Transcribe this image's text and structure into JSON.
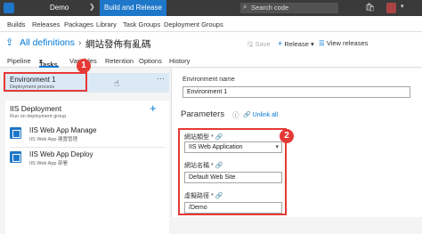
{
  "topbar": {
    "project": "Demo",
    "active_hub": "Build and Release",
    "search_placeholder": "Search code",
    "chevron": "❯",
    "search_icon": "search-icon",
    "cart_icon": "cart-icon"
  },
  "subnav": {
    "items": [
      "Builds",
      "Releases",
      "Packages",
      "Library",
      "Task Groups",
      "Deployment Groups"
    ]
  },
  "titlebar": {
    "breadcrumb": "All definitions",
    "separator": "›",
    "title": "網站發佈有亂碼",
    "save_label": "Save",
    "release_label": "Release",
    "view_releases_label": "View releases"
  },
  "tabs": {
    "items": [
      "Pipeline",
      "Tasks",
      "Variables",
      "Retention",
      "Options",
      "History"
    ],
    "active": "Tasks"
  },
  "environment": {
    "name": "Environment 1",
    "subtitle": "Deployment process"
  },
  "phase": {
    "title": "IIS Deployment",
    "subtitle": "Run on deployment group",
    "tasks": [
      {
        "name": "IIS Web App Manage",
        "subtitle": "IIS Web App 建置管理"
      },
      {
        "name": "IIS Web App Deploy",
        "subtitle": "IIS Web App 部署"
      }
    ]
  },
  "details": {
    "env_name_label": "Environment name",
    "env_name_value": "Environment 1",
    "parameters_label": "Parameters",
    "unlink_label": "Unlink all",
    "fields": [
      {
        "label": "網站類型 *",
        "value": "IIS Web Application"
      },
      {
        "label": "網站名稱 *",
        "value": "Default Web Site"
      },
      {
        "label": "虛擬路徑 *",
        "value": "/Demo"
      }
    ]
  },
  "callouts": {
    "one": "1",
    "two": "2",
    "color": "#e53935"
  },
  "colors": {
    "accent": "#1e77c8",
    "link": "#0078d7",
    "selected_bg": "#dbe9f7"
  }
}
